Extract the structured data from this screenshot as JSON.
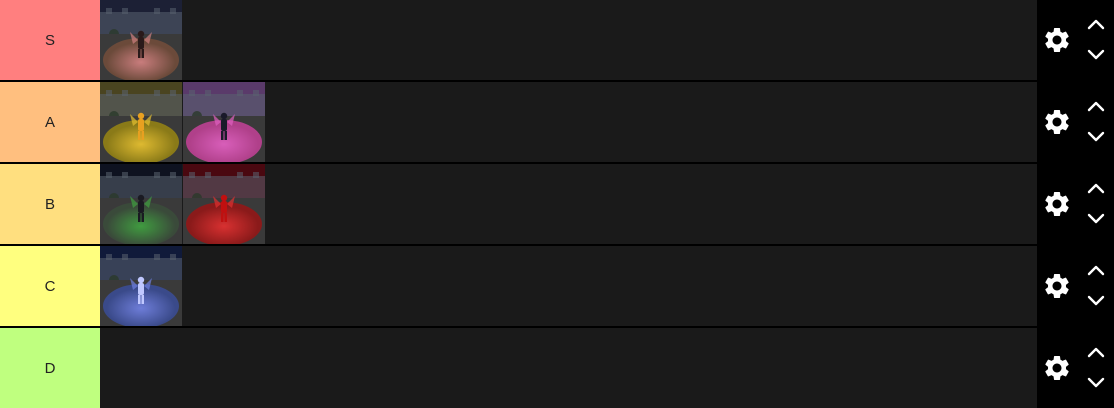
{
  "tiers": [
    {
      "label": "S",
      "color": "#ff7f7f",
      "items": [
        {
          "scene": "dark-knight",
          "sky": "#1c2035",
          "ground": "#6b4a3a",
          "glow": "#d08080",
          "figure": "#2a1a1a"
        }
      ]
    },
    {
      "label": "A",
      "color": "#ffbf7f",
      "items": [
        {
          "scene": "golden-wings",
          "sky": "#4a4420",
          "ground": "#8a7a18",
          "glow": "#e6c030",
          "figure": "#e8a020"
        },
        {
          "scene": "pink-wings",
          "sky": "#5a3a6a",
          "ground": "#b0408a",
          "glow": "#e060c0",
          "figure": "#1a1a2a"
        }
      ]
    },
    {
      "label": "B",
      "color": "#ffdf7f",
      "items": [
        {
          "scene": "green-aura",
          "sky": "#0e1220",
          "ground": "#3a4a3a",
          "glow": "#40a040",
          "figure": "#1a1a22"
        },
        {
          "scene": "red-demon",
          "sky": "#4a0810",
          "ground": "#8a1a1a",
          "glow": "#e03030",
          "figure": "#c01010"
        }
      ]
    },
    {
      "label": "C",
      "color": "#ffff7f",
      "items": [
        {
          "scene": "blue-aura",
          "sky": "#101a3a",
          "ground": "#3a4a8a",
          "glow": "#7080e0",
          "figure": "#c0c8ff"
        }
      ]
    },
    {
      "label": "D",
      "color": "#bfff7f",
      "items": []
    }
  ],
  "icons": {
    "settings": "gear-icon",
    "up": "chevron-up-icon",
    "down": "chevron-down-icon"
  }
}
